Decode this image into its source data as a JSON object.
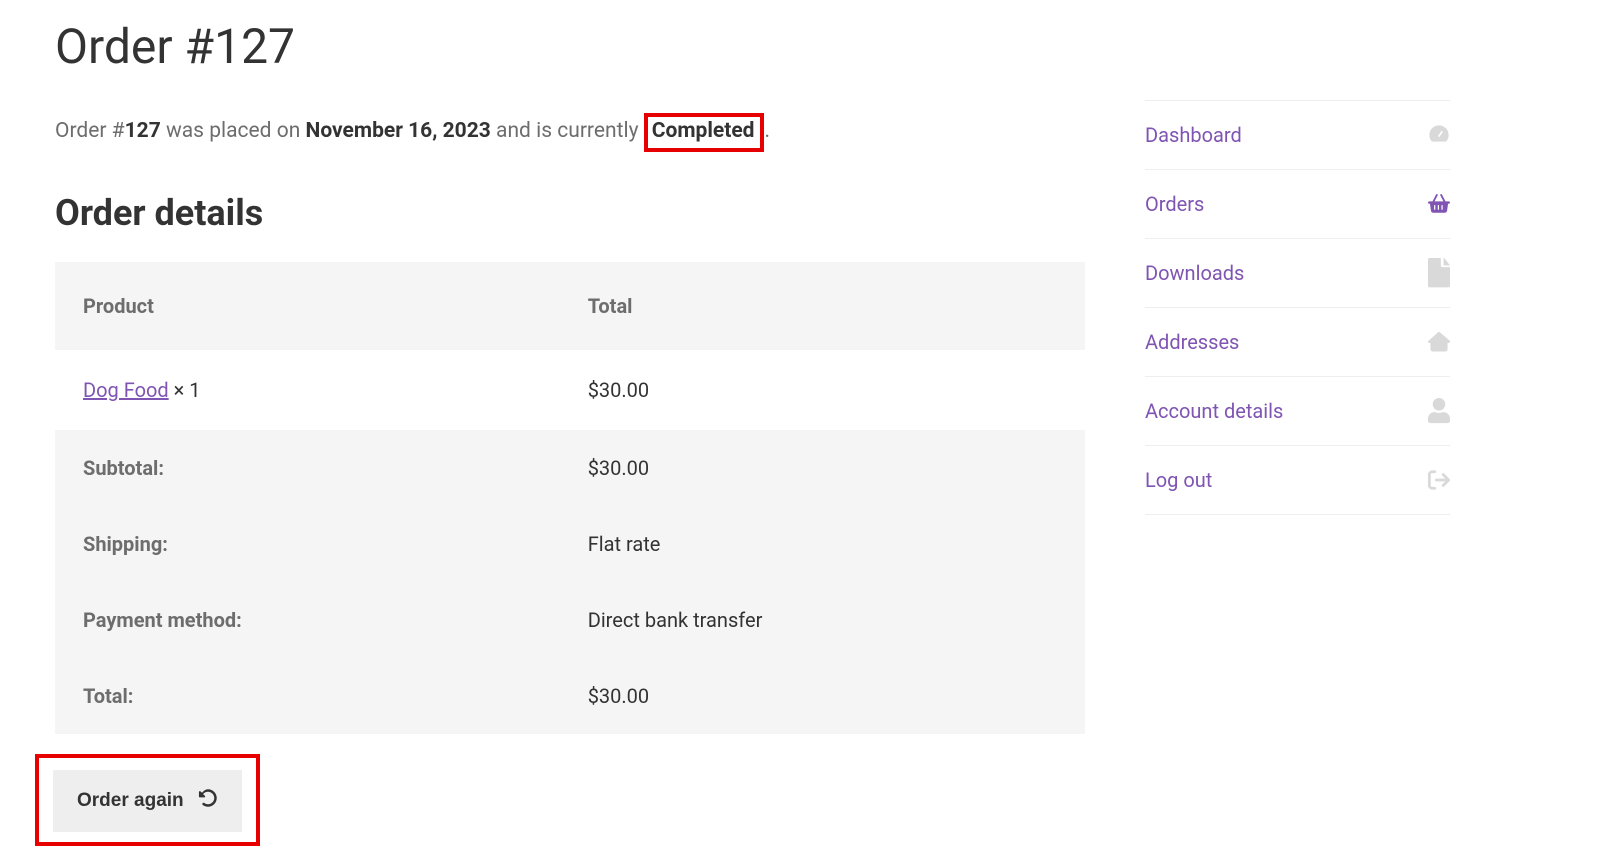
{
  "page": {
    "title": "Order #127",
    "summary": {
      "prefix": "Order #",
      "order_number": "127",
      "placed_on_text": " was placed on ",
      "date": "November 16, 2023",
      "status_prefix": " and is currently ",
      "status": "Completed",
      "period": "."
    },
    "section_title": "Order details"
  },
  "table": {
    "headers": {
      "product": "Product",
      "total": "Total"
    },
    "line_item": {
      "product_name": "Dog Food",
      "quantity_text": " × 1",
      "total": "$30.00"
    },
    "rows": [
      {
        "label": "Subtotal:",
        "value": "$30.00"
      },
      {
        "label": "Shipping:",
        "value": "Flat rate"
      },
      {
        "label": "Payment method:",
        "value": "Direct bank transfer"
      },
      {
        "label": "Total:",
        "value": "$30.00"
      }
    ]
  },
  "actions": {
    "order_again": "Order again"
  },
  "sidebar": {
    "items": [
      {
        "label": "Dashboard",
        "icon": "dashboard-icon"
      },
      {
        "label": "Orders",
        "icon": "basket-icon"
      },
      {
        "label": "Downloads",
        "icon": "file-icon"
      },
      {
        "label": "Addresses",
        "icon": "home-icon"
      },
      {
        "label": "Account details",
        "icon": "user-icon"
      },
      {
        "label": "Log out",
        "icon": "logout-icon"
      }
    ]
  }
}
